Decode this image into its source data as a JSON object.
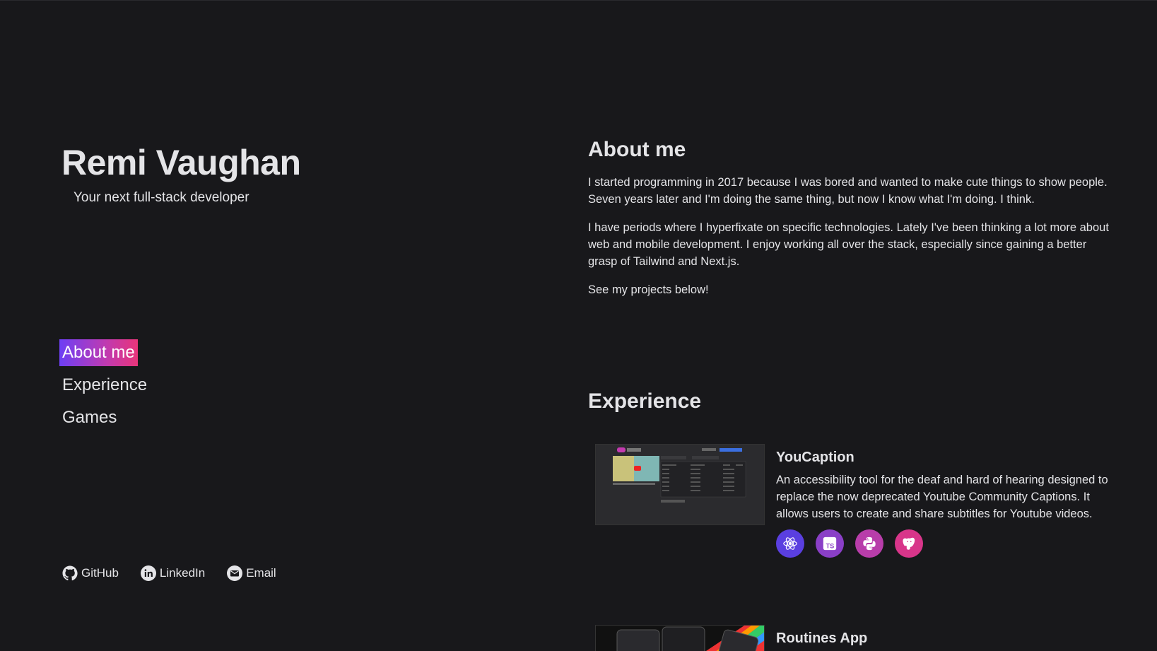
{
  "header": {
    "name": "Remi Vaughan",
    "tagline": "Your next full-stack developer"
  },
  "nav": {
    "items": [
      {
        "label": "About me",
        "active": true
      },
      {
        "label": "Experience",
        "active": false
      },
      {
        "label": "Games",
        "active": false
      }
    ]
  },
  "socials": [
    {
      "label": "GitHub",
      "icon": "github-icon"
    },
    {
      "label": "LinkedIn",
      "icon": "linkedin-icon"
    },
    {
      "label": "Email",
      "icon": "email-icon"
    }
  ],
  "about": {
    "title": "About me",
    "paragraphs": [
      "I started programming in 2017 because I was bored and wanted to make cute things to show people. Seven years later and I'm doing the same thing, but now I know what I'm doing. I think.",
      "I have periods where I hyperfixate on specific technologies. Lately I've been thinking a lot more about web and mobile development. I enjoy working all over the stack, especially since gaining a better grasp of Tailwind and Next.js.",
      "See my projects below!"
    ]
  },
  "experience": {
    "title": "Experience",
    "projects": [
      {
        "title": "YouCaption",
        "description": "An accessibility tool for the deaf and hard of hearing designed to replace the now deprecated Youtube Community Captions. It allows users to create and share subtitles for Youtube videos.",
        "tech": [
          {
            "icon": "react-icon",
            "color": "#5a3fe0"
          },
          {
            "icon": "typescript-icon",
            "color": "#8a3fc7"
          },
          {
            "icon": "python-icon",
            "color": "#b83daa"
          },
          {
            "icon": "postgresql-icon",
            "color": "#d8358a"
          }
        ]
      },
      {
        "title": "Routines App"
      }
    ]
  },
  "colors": {
    "background": "#18181b",
    "text": "#e4e4e7",
    "accent_start": "#6d3ff5",
    "accent_end": "#e8357a"
  }
}
